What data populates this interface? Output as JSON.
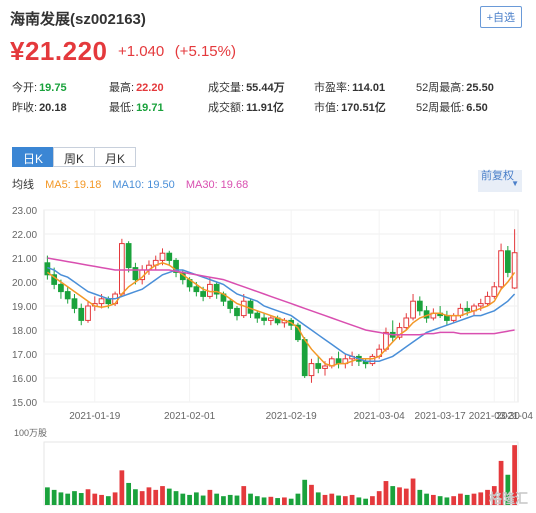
{
  "header": {
    "name": "海南发展(sz002163)",
    "add_label": "+自选"
  },
  "quote": {
    "price": "¥21.220",
    "change": "+1.040",
    "change_pct": "(+5.15%)"
  },
  "stats": [
    {
      "label": "今开:",
      "value": "19.75",
      "tone": "down"
    },
    {
      "label": "最高:",
      "value": "22.20",
      "tone": "up"
    },
    {
      "label": "成交量:",
      "value": "55.44万",
      "tone": ""
    },
    {
      "label": "市盈率:",
      "value": "114.01",
      "tone": ""
    },
    {
      "label": "52周最高:",
      "value": "25.50",
      "tone": ""
    },
    {
      "label": "昨收:",
      "value": "20.18",
      "tone": ""
    },
    {
      "label": "最低:",
      "value": "19.71",
      "tone": "down"
    },
    {
      "label": "成交额:",
      "value": "11.91亿",
      "tone": ""
    },
    {
      "label": "市值:",
      "value": "170.51亿",
      "tone": ""
    },
    {
      "label": "52周最低:",
      "value": "6.50",
      "tone": ""
    }
  ],
  "tabs": [
    {
      "label": "日K",
      "active": true
    },
    {
      "label": "周K",
      "active": false
    },
    {
      "label": "月K",
      "active": false
    }
  ],
  "ma": {
    "label": "均线",
    "ma5": "MA5: 19.18",
    "ma10": "MA10: 19.50",
    "ma30": "MA30: 19.68"
  },
  "adjust_label": "前复权",
  "volume_unit": "100万股",
  "watermark": "格隆汇",
  "colors": {
    "up": "#e4393c",
    "down": "#1aa23c",
    "ma5": "#f39826",
    "ma10": "#4a8fd8",
    "ma30": "#d94fb0",
    "accent": "#3b86d4"
  },
  "chart_data": {
    "type": "candlestick",
    "ylim": [
      15.0,
      23.0
    ],
    "yticks": [
      "23.00",
      "22.00",
      "21.00",
      "20.00",
      "19.00",
      "18.00",
      "17.00",
      "16.00",
      "15.00"
    ],
    "xticks": [
      "2021-01-19",
      "2021-02-01",
      "2021-02-19",
      "2021-03-04",
      "2021-03-17",
      "2021-03-30",
      "2021-04"
    ],
    "candles": [
      [
        20.8,
        21.1,
        20.1,
        20.3
      ],
      [
        20.3,
        20.6,
        19.7,
        19.9
      ],
      [
        19.9,
        20.1,
        19.3,
        19.6
      ],
      [
        19.6,
        19.8,
        19.1,
        19.3
      ],
      [
        19.3,
        19.5,
        18.7,
        18.9
      ],
      [
        18.9,
        19.1,
        18.2,
        18.4
      ],
      [
        18.4,
        19.2,
        18.3,
        19.0
      ],
      [
        19.0,
        19.4,
        18.8,
        19.1
      ],
      [
        19.1,
        19.5,
        18.9,
        19.3
      ],
      [
        19.3,
        19.4,
        18.9,
        19.1
      ],
      [
        19.1,
        19.6,
        19.0,
        19.5
      ],
      [
        19.5,
        21.8,
        19.4,
        21.6
      ],
      [
        21.6,
        21.7,
        20.4,
        20.6
      ],
      [
        20.6,
        20.8,
        19.9,
        20.1
      ],
      [
        20.1,
        20.7,
        19.9,
        20.5
      ],
      [
        20.5,
        20.9,
        20.3,
        20.7
      ],
      [
        20.7,
        21.1,
        20.5,
        20.9
      ],
      [
        20.9,
        21.4,
        20.7,
        21.2
      ],
      [
        21.2,
        21.3,
        20.7,
        20.9
      ],
      [
        20.9,
        21.0,
        20.2,
        20.4
      ],
      [
        20.4,
        20.5,
        19.9,
        20.1
      ],
      [
        20.1,
        20.2,
        19.6,
        19.8
      ],
      [
        19.8,
        20.0,
        19.4,
        19.6
      ],
      [
        19.6,
        19.8,
        19.2,
        19.4
      ],
      [
        19.4,
        20.2,
        19.3,
        19.9
      ],
      [
        19.9,
        20.0,
        19.3,
        19.5
      ],
      [
        19.5,
        19.6,
        19.0,
        19.2
      ],
      [
        19.2,
        19.3,
        18.7,
        18.9
      ],
      [
        18.9,
        19.0,
        18.4,
        18.6
      ],
      [
        18.6,
        19.5,
        18.5,
        19.2
      ],
      [
        19.2,
        19.3,
        18.5,
        18.7
      ],
      [
        18.7,
        18.8,
        18.3,
        18.5
      ],
      [
        18.5,
        18.7,
        18.2,
        18.4
      ],
      [
        18.4,
        18.6,
        18.2,
        18.5
      ],
      [
        18.5,
        18.6,
        18.2,
        18.3
      ],
      [
        18.3,
        18.5,
        18.1,
        18.4
      ],
      [
        18.4,
        18.5,
        18.0,
        18.2
      ],
      [
        18.2,
        18.3,
        17.5,
        17.6
      ],
      [
        17.6,
        17.7,
        16.0,
        16.1
      ],
      [
        16.1,
        16.8,
        15.8,
        16.6
      ],
      [
        16.6,
        16.9,
        16.2,
        16.4
      ],
      [
        16.4,
        16.7,
        16.1,
        16.5
      ],
      [
        16.5,
        16.9,
        16.4,
        16.8
      ],
      [
        16.8,
        17.1,
        16.4,
        16.6
      ],
      [
        16.6,
        17.0,
        16.4,
        16.8
      ],
      [
        16.8,
        17.1,
        16.5,
        16.9
      ],
      [
        16.9,
        17.0,
        16.5,
        16.7
      ],
      [
        16.7,
        16.8,
        16.4,
        16.6
      ],
      [
        16.6,
        17.0,
        16.5,
        16.9
      ],
      [
        16.9,
        17.4,
        16.8,
        17.2
      ],
      [
        17.2,
        18.1,
        17.1,
        17.9
      ],
      [
        17.9,
        18.4,
        17.5,
        17.7
      ],
      [
        17.7,
        18.3,
        17.6,
        18.1
      ],
      [
        18.1,
        18.7,
        18.0,
        18.5
      ],
      [
        18.5,
        19.5,
        18.4,
        19.2
      ],
      [
        19.2,
        19.4,
        18.6,
        18.8
      ],
      [
        18.8,
        19.0,
        18.3,
        18.5
      ],
      [
        18.5,
        18.9,
        18.4,
        18.7
      ],
      [
        18.7,
        19.0,
        18.5,
        18.6
      ],
      [
        18.6,
        18.8,
        18.2,
        18.4
      ],
      [
        18.4,
        18.7,
        18.3,
        18.6
      ],
      [
        18.6,
        19.1,
        18.5,
        18.9
      ],
      [
        18.9,
        19.2,
        18.6,
        18.8
      ],
      [
        18.8,
        19.1,
        18.6,
        19.0
      ],
      [
        19.0,
        19.3,
        18.8,
        19.1
      ],
      [
        19.1,
        19.6,
        19.0,
        19.4
      ],
      [
        19.4,
        20.0,
        19.3,
        19.8
      ],
      [
        19.8,
        21.6,
        19.7,
        21.3
      ],
      [
        21.3,
        21.5,
        20.2,
        20.4
      ],
      [
        19.75,
        22.2,
        19.71,
        21.22
      ]
    ],
    "ma5": [
      20.4,
      20.2,
      20.0,
      19.8,
      19.6,
      19.4,
      19.2,
      19.0,
      18.95,
      19.0,
      19.1,
      19.5,
      19.8,
      20.0,
      20.2,
      20.5,
      20.7,
      20.8,
      20.7,
      20.5,
      20.3,
      20.1,
      19.9,
      19.7,
      19.6,
      19.6,
      19.5,
      19.3,
      19.1,
      19.0,
      18.9,
      18.8,
      18.7,
      18.6,
      18.5,
      18.4,
      18.3,
      18.1,
      17.6,
      17.2,
      16.9,
      16.6,
      16.5,
      16.6,
      16.6,
      16.7,
      16.8,
      16.8,
      16.8,
      16.9,
      17.2,
      17.5,
      17.8,
      18.0,
      18.3,
      18.5,
      18.6,
      18.7,
      18.7,
      18.6,
      18.6,
      18.6,
      18.7,
      18.8,
      18.9,
      19.0,
      19.2,
      19.7,
      20.0,
      20.4
    ],
    "ma10": [
      20.6,
      20.5,
      20.3,
      20.2,
      20.0,
      19.8,
      19.6,
      19.5,
      19.4,
      19.3,
      19.3,
      19.4,
      19.5,
      19.6,
      19.7,
      19.9,
      20.1,
      20.3,
      20.4,
      20.5,
      20.5,
      20.4,
      20.3,
      20.2,
      20.1,
      20.0,
      19.9,
      19.7,
      19.5,
      19.4,
      19.3,
      19.2,
      19.0,
      18.9,
      18.8,
      18.7,
      18.6,
      18.4,
      18.2,
      18.0,
      17.8,
      17.6,
      17.4,
      17.2,
      17.0,
      16.9,
      16.8,
      16.7,
      16.7,
      16.7,
      16.8,
      16.9,
      17.1,
      17.3,
      17.5,
      17.7,
      17.9,
      18.0,
      18.1,
      18.2,
      18.3,
      18.4,
      18.5,
      18.6,
      18.6,
      18.7,
      18.8,
      19.0,
      19.2,
      19.5
    ],
    "ma30": [
      21.0,
      20.95,
      20.9,
      20.85,
      20.8,
      20.75,
      20.7,
      20.65,
      20.6,
      20.55,
      20.5,
      20.5,
      20.5,
      20.5,
      20.5,
      20.5,
      20.5,
      20.5,
      20.5,
      20.45,
      20.4,
      20.35,
      20.3,
      20.25,
      20.2,
      20.15,
      20.1,
      20.0,
      19.9,
      19.8,
      19.7,
      19.6,
      19.5,
      19.4,
      19.3,
      19.2,
      19.1,
      19.0,
      18.9,
      18.8,
      18.7,
      18.6,
      18.5,
      18.4,
      18.3,
      18.2,
      18.1,
      18.0,
      17.95,
      17.9,
      17.85,
      17.8,
      17.8,
      17.8,
      17.8,
      17.8,
      17.85,
      17.85,
      17.9,
      17.9,
      17.9,
      17.85,
      17.85,
      17.85,
      17.85,
      17.85,
      17.85,
      17.9,
      17.95,
      18.0
    ],
    "volume_ylim": [
      0,
      100
    ],
    "volumes": [
      28,
      24,
      20,
      18,
      22,
      19,
      25,
      18,
      16,
      14,
      20,
      55,
      35,
      25,
      22,
      28,
      24,
      30,
      26,
      22,
      18,
      16,
      20,
      15,
      24,
      18,
      14,
      16,
      15,
      30,
      18,
      14,
      12,
      13,
      11,
      12,
      10,
      18,
      40,
      32,
      20,
      16,
      18,
      15,
      14,
      16,
      12,
      10,
      14,
      22,
      38,
      30,
      28,
      26,
      42,
      24,
      18,
      16,
      14,
      12,
      14,
      18,
      16,
      18,
      20,
      24,
      30,
      70,
      48,
      95
    ]
  }
}
